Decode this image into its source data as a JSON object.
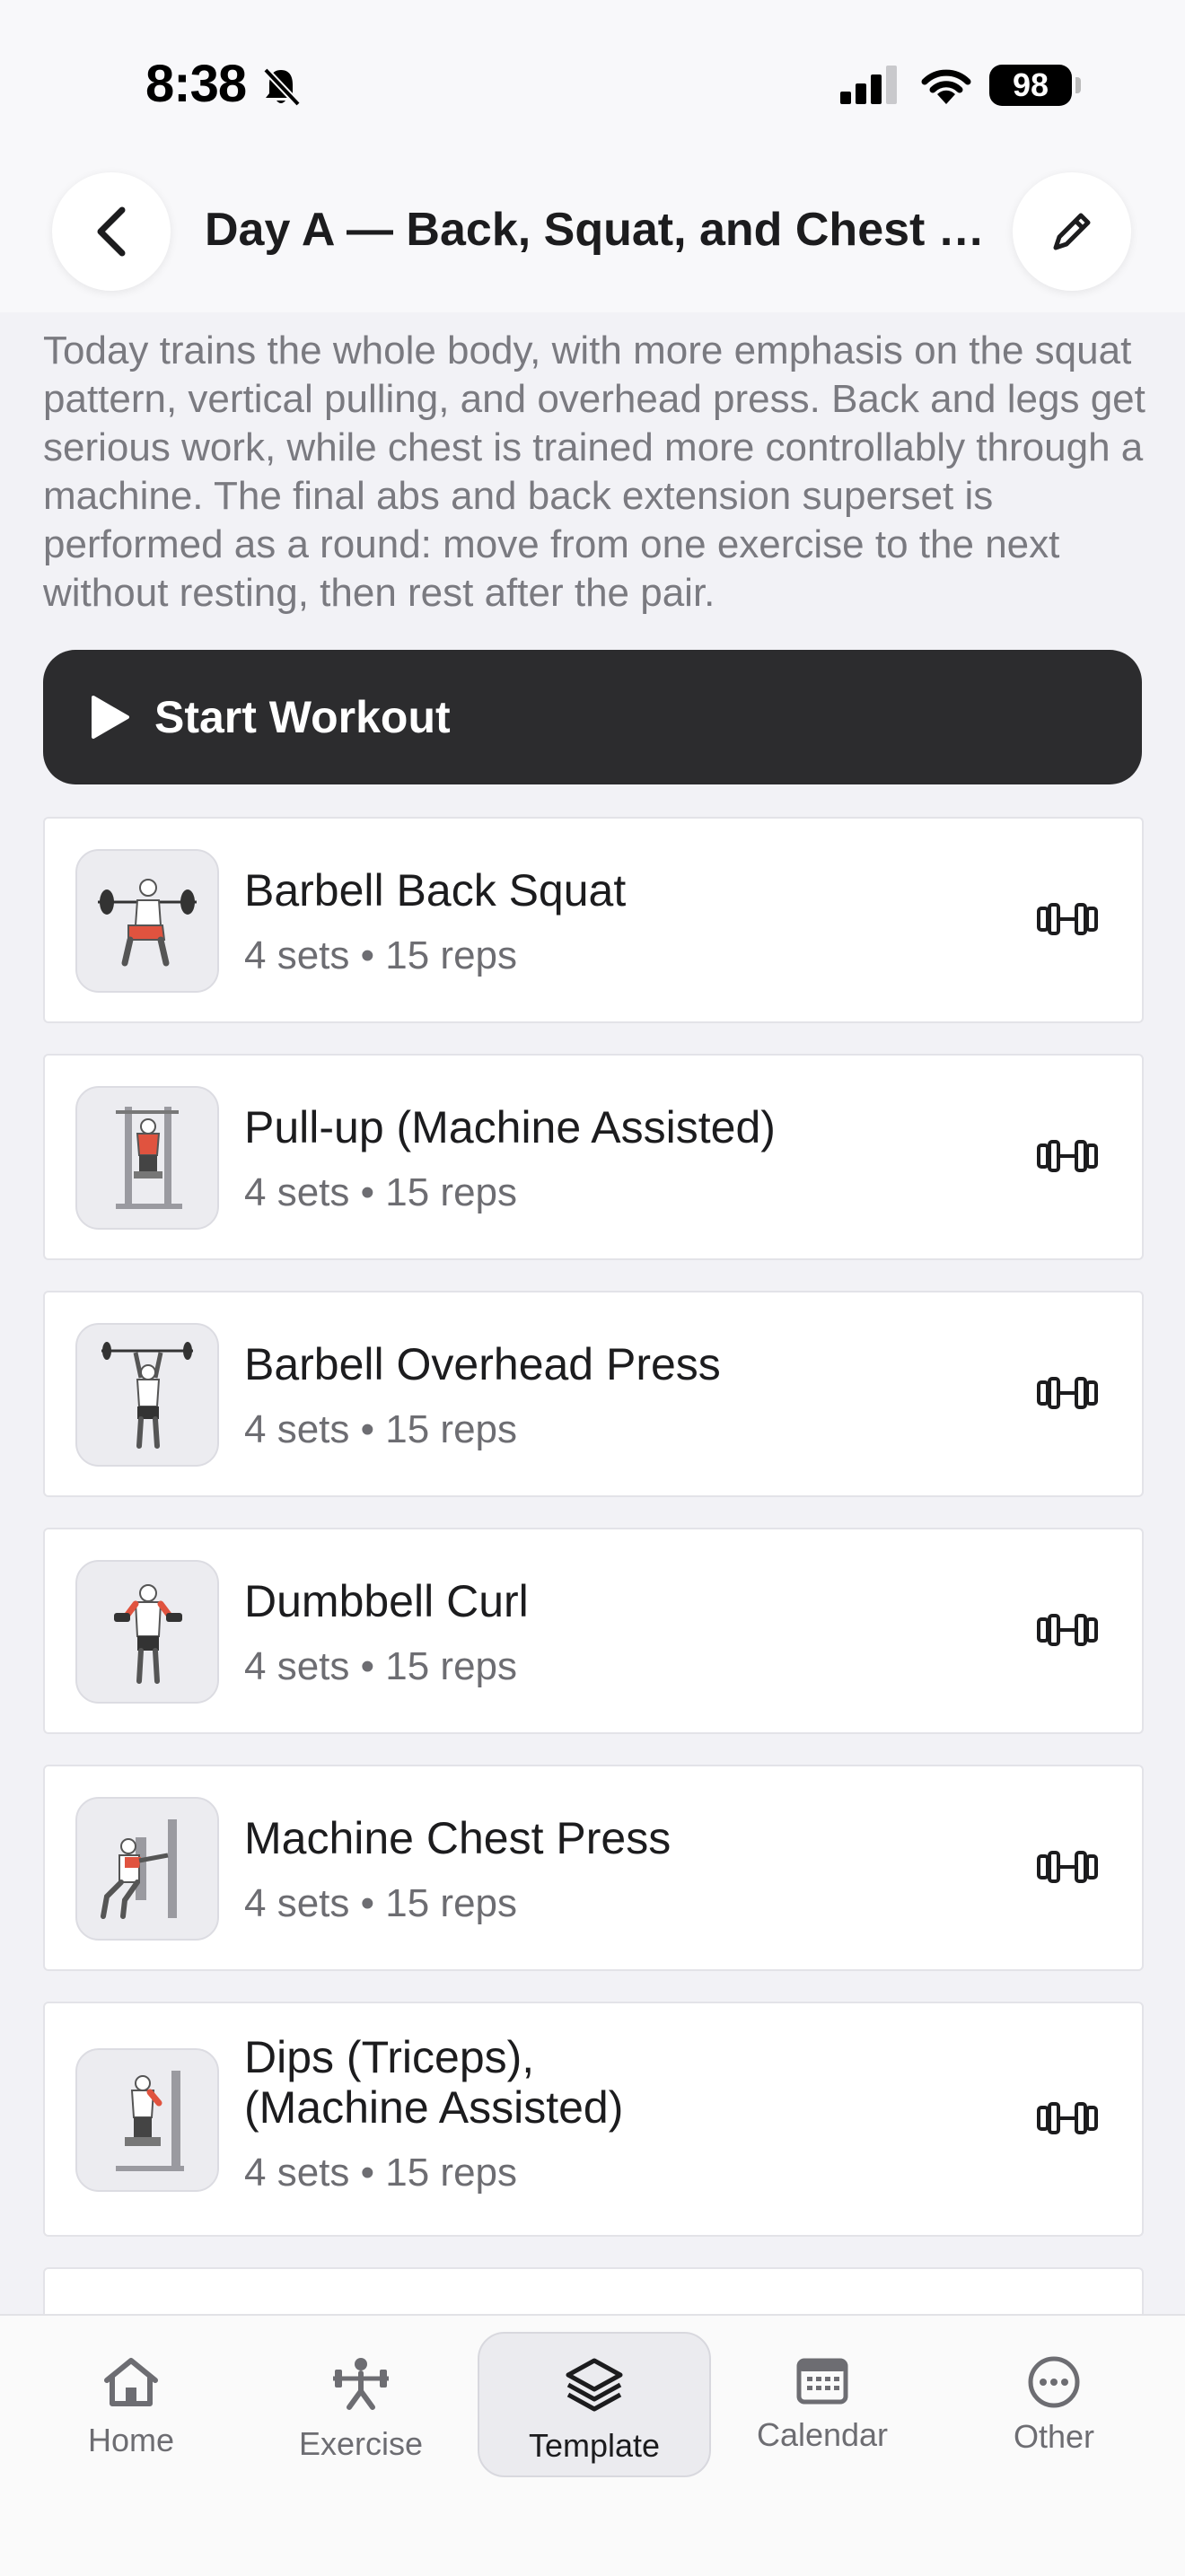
{
  "status_bar": {
    "time": "8:38",
    "battery": "98"
  },
  "header": {
    "title": "Day A — Back, Squat, and Chest S..."
  },
  "description": "Today trains the whole body, with more emphasis on the squat pattern, vertical pulling, and overhead press. Back and legs get serious work, while chest is trained more controllably through a machine. The final abs and back extension superset is performed as a round: move from one exercise to the next without resting, then rest after the pair.",
  "start_button": {
    "label": "Start Workout"
  },
  "exercises": [
    {
      "name": "Barbell Back Squat",
      "sets": "4 sets",
      "reps": "15 reps"
    },
    {
      "name": "Pull-up (Machine Assisted)",
      "sets": "4 sets",
      "reps": "15 reps"
    },
    {
      "name": "Barbell Overhead Press",
      "sets": "4 sets",
      "reps": "15 reps"
    },
    {
      "name": "Dumbbell Curl",
      "sets": "4 sets",
      "reps": "15 reps"
    },
    {
      "name": "Machine Chest Press",
      "sets": "4 sets",
      "reps": "15 reps"
    },
    {
      "name": "Dips (Triceps),",
      "name_line2": "(Machine Assisted)",
      "sets": "4 sets",
      "reps": "15 reps"
    }
  ],
  "meta_separator": "•",
  "tab_bar": {
    "tabs": [
      {
        "label": "Home",
        "icon": "home-icon"
      },
      {
        "label": "Exercise",
        "icon": "exercise-icon"
      },
      {
        "label": "Template",
        "icon": "layers-icon",
        "active": true
      },
      {
        "label": "Calendar",
        "icon": "calendar-icon"
      },
      {
        "label": "Other",
        "icon": "more-icon"
      }
    ]
  },
  "colors": {
    "primary_button": "#2c2c2e",
    "accent_muscle": "#e0533f",
    "background": "#f2f2f6"
  }
}
